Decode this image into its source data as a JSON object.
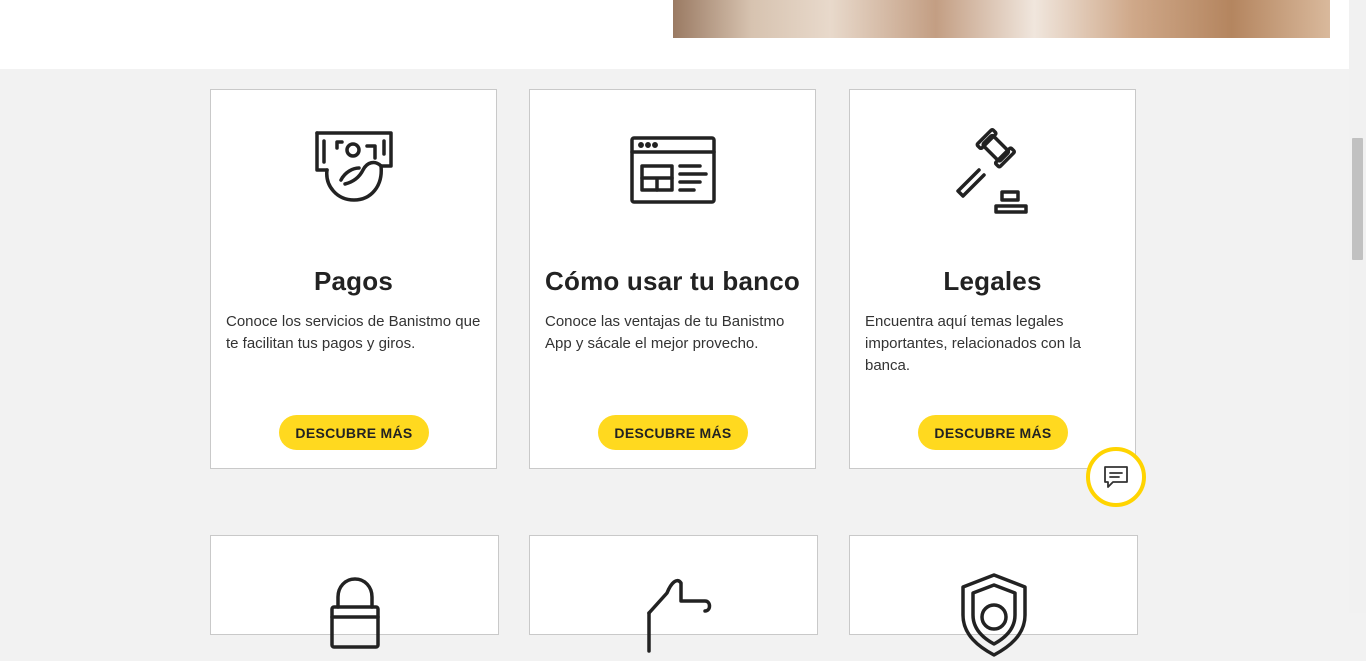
{
  "hero": {
    "image": "banner-photo"
  },
  "cards": [
    {
      "icon": "payment-hand-icon",
      "title": "Pagos",
      "description": "Conoce los servicios de Banistmo que te facilitan tus pagos y giros.",
      "cta": "DESCUBRE MÁS"
    },
    {
      "icon": "browser-window-icon",
      "title": "Cómo usar tu banco",
      "description": "Conoce las ventajas de tu Banistmo App y sácale el mejor provecho.",
      "cta": "DESCUBRE MÁS"
    },
    {
      "icon": "gavel-icon",
      "title": "Legales",
      "description": "Encuentra aquí temas legales importantes, relacionados con la banca.",
      "cta": "DESCUBRE MÁS"
    }
  ],
  "second_row": [
    {
      "icon": "lock-icon"
    },
    {
      "icon": "thumbs-up-icon"
    },
    {
      "icon": "shield-check-icon"
    }
  ],
  "chat": {
    "icon": "chat-bubble-icon"
  },
  "colors": {
    "accent": "#ffd91f",
    "chat_ring": "#ffd400",
    "background": "#f2f2f2"
  }
}
